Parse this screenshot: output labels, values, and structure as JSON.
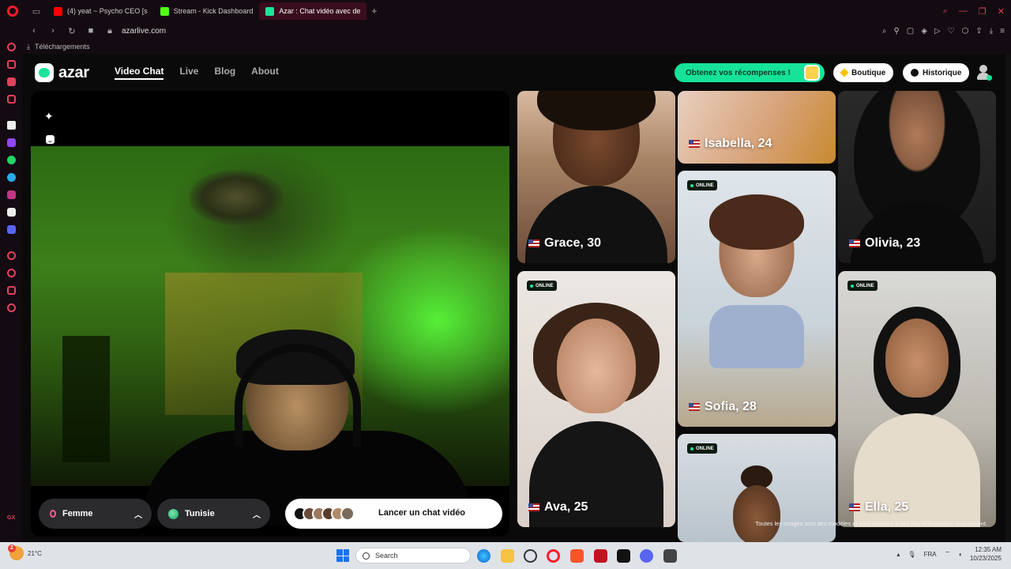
{
  "browser": {
    "tabs": [
      {
        "label": "(4) yeat ~ Psycho CEO [s",
        "color": "#ff0000"
      },
      {
        "label": "Stream - Kick Dashboard",
        "color": "#53fc18"
      },
      {
        "label": "Azar : Chat vidéo avec de",
        "color": "#1be59a",
        "active": true
      }
    ],
    "url": "azarlive.com",
    "downloads_label": "Téléchargements"
  },
  "nav": {
    "logo": "azar",
    "links": [
      "Video Chat",
      "Live",
      "Blog",
      "About"
    ],
    "rewards": "Obtenez vos récompenses !",
    "shop": "Boutique",
    "history": "Historique"
  },
  "controls": {
    "gender": "Femme",
    "country": "Tunisie",
    "launch": "Lancer un chat vidéo"
  },
  "profiles": [
    {
      "name": "Grace, 30",
      "online": false
    },
    {
      "name": "Isabella, 24",
      "online": false
    },
    {
      "name": "Olivia, 23",
      "online": false
    },
    {
      "name": "Sofia, 28",
      "online": true
    },
    {
      "name": "Ava, 25",
      "online": true
    },
    {
      "name": "Ella, 25",
      "online": true
    },
    {
      "name": "",
      "online": true
    }
  ],
  "online_label": "ONLINE",
  "disclaimer": "Toutes les images sont des modèles et sont utilisées à des fins d'illustration uniquement.",
  "taskbar": {
    "weather_temp": "21°C",
    "weather_badge": "2",
    "search": "Search",
    "lang": "FRA",
    "time": "12:35 AM",
    "date": "10/23/2025"
  }
}
